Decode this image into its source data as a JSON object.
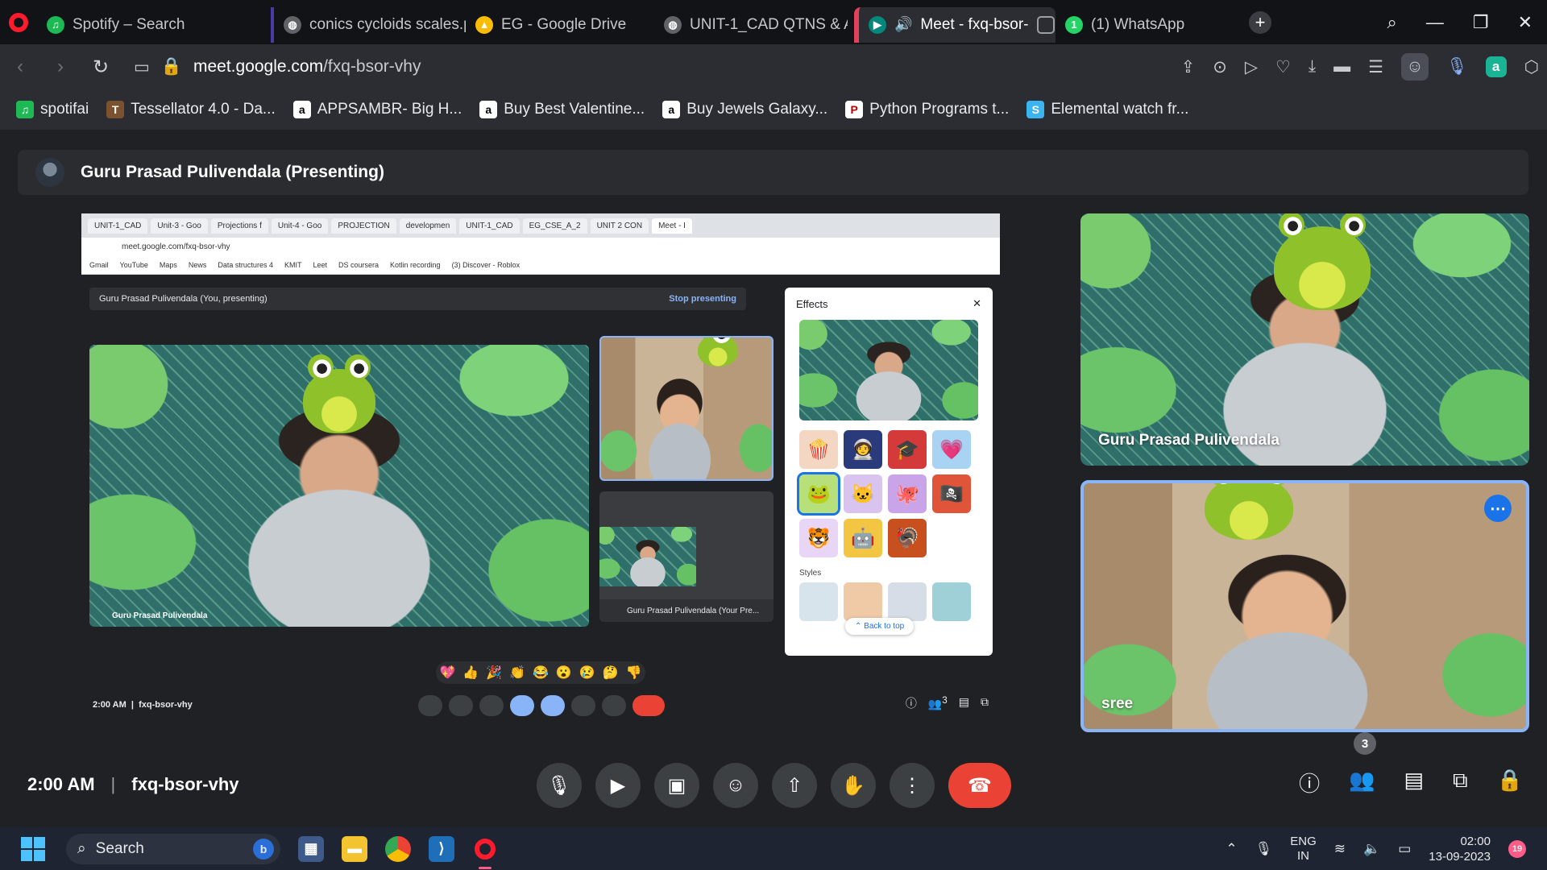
{
  "browser": {
    "tabs": [
      {
        "label": "Spotify – Search",
        "icon": "spotify-icon",
        "color": "#1db954",
        "active": false
      },
      {
        "label": "conics cycloids scales.p",
        "icon": "globe-icon",
        "color": "#9aa0a6",
        "active": false
      },
      {
        "label": "EG - Google Drive",
        "icon": "drive-icon",
        "color": "#fbbc04",
        "active": false
      },
      {
        "label": "UNIT-1_CAD QTNS & A",
        "icon": "globe-icon",
        "color": "#9aa0a6",
        "active": false
      },
      {
        "label": "Meet - fxq-bsor-",
        "icon": "meet-icon",
        "color": "#00897b",
        "active": true
      },
      {
        "label": "(1) WhatsApp",
        "icon": "whatsapp-icon",
        "color": "#25d366",
        "active": false
      }
    ],
    "url_prefix": "meet.google.com",
    "url_path": "/fxq-bsor-vhy",
    "bookmarks": [
      {
        "label": "spotifai",
        "icon": "spotify-icon",
        "color": "#1db954",
        "glyph": "♫"
      },
      {
        "label": "Tessellator 4.0 - Da...",
        "icon": "tessellator-icon",
        "color": "#7a5230",
        "glyph": "T"
      },
      {
        "label": "APPSAMBR- Big H...",
        "icon": "amazon-icon",
        "color": "#ffffff",
        "glyph": "a"
      },
      {
        "label": "Buy Best Valentine...",
        "icon": "amazon-icon",
        "color": "#ffffff",
        "glyph": "a"
      },
      {
        "label": "Buy Jewels Galaxy...",
        "icon": "amazon-icon",
        "color": "#ffffff",
        "glyph": "a"
      },
      {
        "label": "Python Programs t...",
        "icon": "python-icon",
        "color": "#ffffff",
        "glyph": "P"
      },
      {
        "label": "Elemental watch fr...",
        "icon": "elemental-icon",
        "color": "#3bb4f2",
        "glyph": "S"
      }
    ]
  },
  "meet": {
    "presenter_banner": "Guru Prasad Pulivendala (Presenting)",
    "shared_screen": {
      "tabs": [
        "UNIT-1_CAD",
        "Unit-3 - Goo",
        "Projections f",
        "Unit-4 - Goo",
        "PROJECTION",
        "developmen",
        "UNIT-1_CAD",
        "EG_CSE_A_2",
        "UNIT 2 CON",
        "Meet - I"
      ],
      "url": "meet.google.com/fxq-bsor-vhy",
      "bookmarks": [
        "Gmail",
        "YouTube",
        "Maps",
        "News",
        "Data structures 4",
        "KMIT",
        "Leet",
        "DS coursera",
        "Kotlin recording",
        "(3) Discover - Roblox"
      ],
      "present_text": "Guru Prasad Pulivendala (You, presenting)",
      "stop_text": "Stop presenting",
      "main_name": "Guru Prasad Pulivendala",
      "tile2_name": "Guru Prasad Pulivendala (Your Pre...",
      "effects_title": "Effects",
      "styles_label": "Styles",
      "back_to_top": "Back to top",
      "time": "2:00 AM",
      "code": "fxq-bsor-vhy",
      "participant_count": "3",
      "reactions": [
        "💖",
        "👍",
        "🎉",
        "👏",
        "😂",
        "😮",
        "😢",
        "🤔",
        "👎"
      ]
    },
    "tiles": [
      {
        "name": "Guru Prasad Pulivendala",
        "speaking": false
      },
      {
        "name": "sree",
        "speaking": true
      }
    ],
    "time": "2:00 AM",
    "code": "fxq-bsor-vhy",
    "participant_count": "3"
  },
  "taskbar": {
    "search_placeholder": "Search",
    "lang_top": "ENG",
    "lang_bottom": "IN",
    "time": "02:00",
    "date": "13-09-2023",
    "notifications": "19"
  },
  "colors": {
    "accent": "#8ab4f8",
    "end_call": "#ea4335",
    "meet_bg": "#202124"
  }
}
